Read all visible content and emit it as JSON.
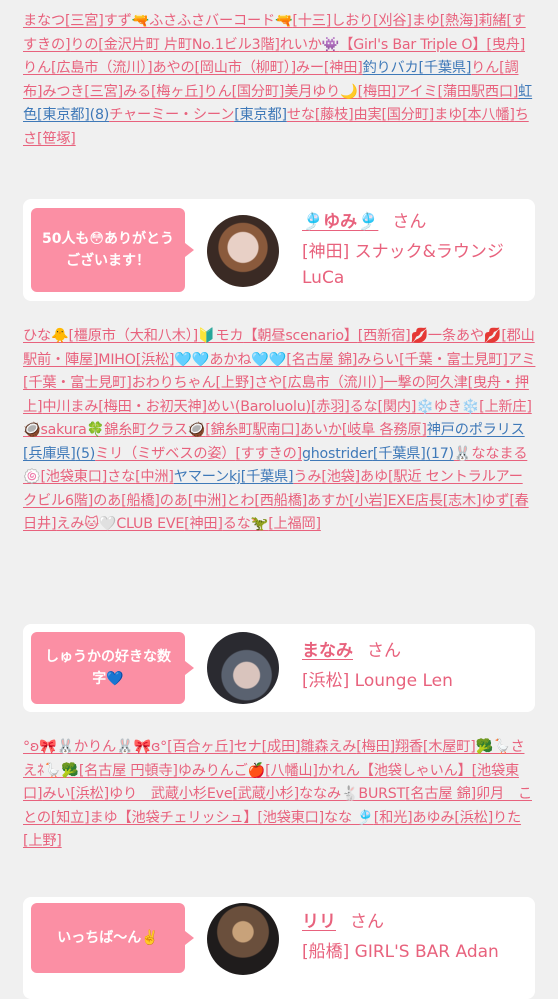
{
  "block1": [
    {
      "t": "まなつ"
    },
    {
      "t": "[三宮]"
    },
    {
      "t": "すず🔫ふさふさバーコード🔫"
    },
    {
      "t": "[十三]"
    },
    {
      "t": "しおり"
    },
    {
      "t": "[刈谷]"
    },
    {
      "t": "まゆ"
    },
    {
      "t": "[熱海]"
    },
    {
      "t": "莉緒"
    },
    {
      "t": "[すすきの]"
    },
    {
      "t": "りの"
    },
    {
      "t": "[金沢片町 片町No.1ビル3階]"
    },
    {
      "t": "れいか👾"
    },
    {
      "t": "【Girl's Bar Triple O】"
    },
    {
      "t": "[曳舟]"
    },
    {
      "t": "りん"
    },
    {
      "t": "[広島市（流川）]"
    },
    {
      "t": "あやの"
    },
    {
      "t": "[岡山市（柳町）]"
    },
    {
      "t": "みー"
    },
    {
      "t": "[神田]"
    },
    {
      "t": "釣りバカ",
      "c": "blue"
    },
    {
      "t": "[千葉県]",
      "c": "blue"
    },
    {
      "t": "りん"
    },
    {
      "t": "[調布]"
    },
    {
      "t": "みつき"
    },
    {
      "t": "[三宮]"
    },
    {
      "t": "みる"
    },
    {
      "t": "[梅ヶ丘]"
    },
    {
      "t": "りん"
    },
    {
      "t": "[国分町]"
    },
    {
      "t": "美月ゆり🌙"
    },
    {
      "t": "[梅田]"
    },
    {
      "t": "アイミ"
    },
    {
      "t": "[蒲田駅西口]"
    },
    {
      "t": "虹色",
      "c": "blue"
    },
    {
      "t": "[東京都]",
      "c": "blue"
    },
    {
      "t": "(8)",
      "c": "blue"
    },
    {
      "t": "チャーミー・シーン"
    },
    {
      "t": "[東京都]",
      "c": "blue"
    },
    {
      "t": "せな"
    },
    {
      "t": "[藤枝]"
    },
    {
      "t": "由実"
    },
    {
      "t": "[国分町]"
    },
    {
      "t": "まゆ"
    },
    {
      "t": "[本八幡]"
    },
    {
      "t": "ちさ"
    },
    {
      "t": "[笹塚]"
    }
  ],
  "card1": {
    "bubble": "50人も😳ありがとうございます！",
    "name": "🎐ゆみ🎐",
    "honorific": "さん",
    "shop": "[神田] スナック&ラウンジLuCa"
  },
  "block2": [
    {
      "t": "ひな🐥"
    },
    {
      "t": "[橿原市（大和八木）]"
    },
    {
      "t": "🔰モカ"
    },
    {
      "t": "【朝昼scenario】"
    },
    {
      "t": "[西新宿]"
    },
    {
      "t": "💋一条あや💋"
    },
    {
      "t": "[郡山駅前・陣屋]"
    },
    {
      "t": "MIHO"
    },
    {
      "t": "[浜松]"
    },
    {
      "t": "🩵🩵あかね🩵🩵"
    },
    {
      "t": "[名古屋 錦]"
    },
    {
      "t": "みらい"
    },
    {
      "t": "[千葉・富士見町]"
    },
    {
      "t": "アミ"
    },
    {
      "t": "[千葉・富士見町]"
    },
    {
      "t": "おわりちゃん"
    },
    {
      "t": "[上野]"
    },
    {
      "t": "さや"
    },
    {
      "t": "[広島市（流川）]"
    },
    {
      "t": "一撃の阿久津"
    },
    {
      "t": "[曳舟・押上]"
    },
    {
      "t": "中川まみ"
    },
    {
      "t": "[梅田・お初天神]"
    },
    {
      "t": "めい"
    },
    {
      "t": "(Baroluolu)"
    },
    {
      "t": "[赤羽]"
    },
    {
      "t": "るな"
    },
    {
      "t": "[関内]"
    },
    {
      "t": "❄️ゆき❄️"
    },
    {
      "t": "[上新庄]"
    },
    {
      "t": "🥥sakura🍀錦糸町クラス🥥"
    },
    {
      "t": "[錦糸町駅南口]"
    },
    {
      "t": "あいか"
    },
    {
      "t": "[岐阜 各務原]"
    },
    {
      "t": "神戸のポラリス",
      "c": "blue"
    },
    {
      "t": "[兵庫県]",
      "c": "blue"
    },
    {
      "t": "(5)",
      "c": "blue"
    },
    {
      "t": "ミリ（ミザベスの姿）"
    },
    {
      "t": "[すすきの]"
    },
    {
      "t": "ghostrider",
      "c": "blue"
    },
    {
      "t": "[千葉県]",
      "c": "blue"
    },
    {
      "t": "(17)",
      "c": "blue"
    },
    {
      "t": "🐰ななまる🍥"
    },
    {
      "t": "[池袋東口]"
    },
    {
      "t": "さな"
    },
    {
      "t": "[中洲]"
    },
    {
      "t": "ヤマーンkj",
      "c": "blue"
    },
    {
      "t": "[千葉県]",
      "c": "blue"
    },
    {
      "t": "うみ"
    },
    {
      "t": "[池袋]"
    },
    {
      "t": "あゆ"
    },
    {
      "t": "[駅近 セントラルアークビル6階]"
    },
    {
      "t": "のあ"
    },
    {
      "t": "[船橋]"
    },
    {
      "t": "のあ"
    },
    {
      "t": "[中洲]"
    },
    {
      "t": "とわ"
    },
    {
      "t": "[西船橋]"
    },
    {
      "t": "あすか"
    },
    {
      "t": "[小岩]"
    },
    {
      "t": "EXE店長"
    },
    {
      "t": "[志木]"
    },
    {
      "t": "ゆず"
    },
    {
      "t": "[春日井]"
    },
    {
      "t": "えみ🐱🤍CLUB EVE"
    },
    {
      "t": "[神田]"
    },
    {
      "t": "るな🦖"
    },
    {
      "t": "[上福岡]"
    }
  ],
  "card2": {
    "bubble": "しゅうかの好きな数字💙",
    "name": "まなみ",
    "honorific": "さん",
    "shop": "[浜松] Lounge Len"
  },
  "block3": [
    {
      "t": "°ʚ🎀🐰かりん🐰🎀ɞ°"
    },
    {
      "t": "[百合ヶ丘]"
    },
    {
      "t": "セナ"
    },
    {
      "t": "[成田]"
    },
    {
      "t": "雛森えみ"
    },
    {
      "t": "[梅田]"
    },
    {
      "t": "翔香"
    },
    {
      "t": "[木屋町]"
    },
    {
      "t": "🥦🪿さえﾈ🪿🥦"
    },
    {
      "t": "[名古屋 円頓寺]"
    },
    {
      "t": "ゆみりんご🍎"
    },
    {
      "t": "[八幡山]"
    },
    {
      "t": "かれん"
    },
    {
      "t": "【池袋しゃいん】"
    },
    {
      "t": "[池袋東口]"
    },
    {
      "t": "みい"
    },
    {
      "t": "[浜松]"
    },
    {
      "t": "ゆり　武蔵小杉Eve"
    },
    {
      "t": "[武蔵小杉]"
    },
    {
      "t": "ななみ🐇BURST"
    },
    {
      "t": "[名古屋 錦]"
    },
    {
      "t": "卯月　ことの"
    },
    {
      "t": "[知立]"
    },
    {
      "t": "まゆ"
    },
    {
      "t": "【池袋チェリッシュ】"
    },
    {
      "t": "[池袋東口]"
    },
    {
      "t": "なな 🎐"
    },
    {
      "t": "[和光]"
    },
    {
      "t": "あゆみ"
    },
    {
      "t": "[浜松]"
    },
    {
      "t": "りた"
    },
    {
      "t": "[上野]"
    }
  ],
  "card3": {
    "bubble": "いっちば〜ん✌️",
    "name": "リリ",
    "honorific": "さん",
    "shop": "[船橋] GIRL'S BAR Adan"
  },
  "colors": {
    "pink": "#e8627d",
    "blue": "#3f79b8",
    "bubble": "#fb8fa4",
    "background": "#f0f0f0"
  }
}
